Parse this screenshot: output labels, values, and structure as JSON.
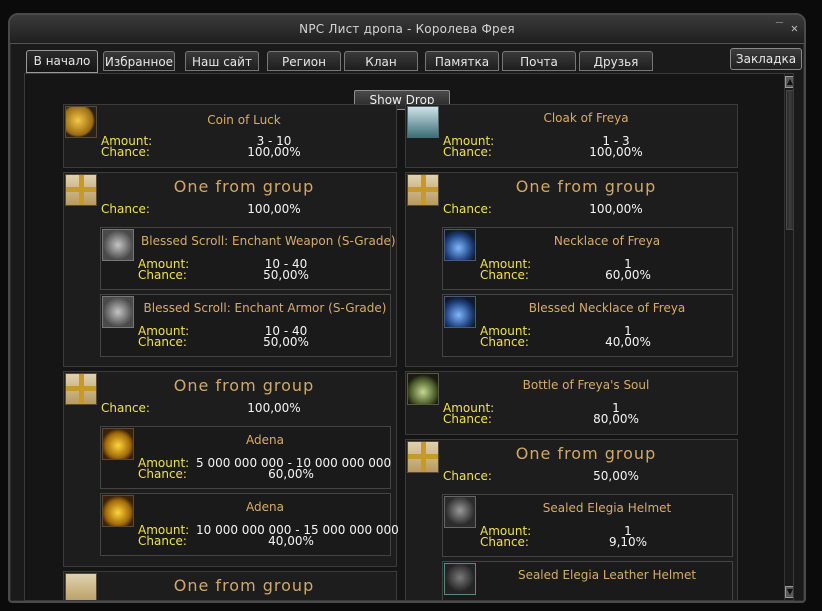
{
  "window": {
    "title": "NPC Лист дропа - Королева Фрея"
  },
  "tabs": [
    {
      "label": "В начало"
    },
    {
      "label": "Избранное"
    },
    {
      "label": "Наш сайт"
    },
    {
      "label": "Регион"
    },
    {
      "label": "Клан"
    },
    {
      "label": "Памятка"
    },
    {
      "label": "Почта"
    },
    {
      "label": "Друзья"
    }
  ],
  "bookmark_label": "Закладка",
  "show_drop_label": "Show Drop",
  "labels": {
    "amount": "Amount:",
    "chance": "Chance:",
    "group": "One from group"
  },
  "left": {
    "coin": {
      "name": "Coin of Luck",
      "amount": "3 - 10",
      "chance": "100,00%"
    },
    "group1": {
      "chance": "100,00%",
      "items": [
        {
          "name": "Blessed Scroll: Enchant Weapon (S-Grade)",
          "amount": "10 - 40",
          "chance": "50,00%"
        },
        {
          "name": "Blessed Scroll: Enchant Armor (S-Grade)",
          "amount": "10 - 40",
          "chance": "50,00%"
        }
      ]
    },
    "group2": {
      "chance": "100,00%",
      "items": [
        {
          "name": "Adena",
          "amount": "5 000 000 000 - 10 000 000 000",
          "chance": "60,00%"
        },
        {
          "name": "Adena",
          "amount": "10 000 000 000 - 15 000 000 000",
          "chance": "40,00%"
        }
      ]
    },
    "group3": {
      "title": "One from group"
    }
  },
  "right": {
    "cloak": {
      "name": "Cloak of Freya",
      "amount": "1 - 3",
      "chance": "100,00%"
    },
    "group1": {
      "chance": "100,00%",
      "items": [
        {
          "name": "Necklace of Freya",
          "amount": "1",
          "chance": "60,00%"
        },
        {
          "name": "Blessed Necklace of Freya",
          "amount": "1",
          "chance": "40,00%"
        }
      ]
    },
    "bottle": {
      "name": "Bottle of Freya's Soul",
      "amount": "1",
      "chance": "80,00%"
    },
    "group2": {
      "chance": "50,00%",
      "items": [
        {
          "name": "Sealed Elegia Helmet",
          "amount": "1",
          "chance": "9,10%"
        },
        {
          "name": "Sealed Elegia Leather Helmet",
          "amount": "",
          "chance": ""
        }
      ]
    }
  },
  "icons": {
    "coin": "coin-of-luck-icon",
    "cloak": "cloak-icon",
    "gift": "gift-box-icon",
    "scroll": "scroll-icon",
    "necklace": "necklace-icon",
    "adena": "adena-icon",
    "bottle": "bottle-icon",
    "helmet": "helmet-icon"
  }
}
